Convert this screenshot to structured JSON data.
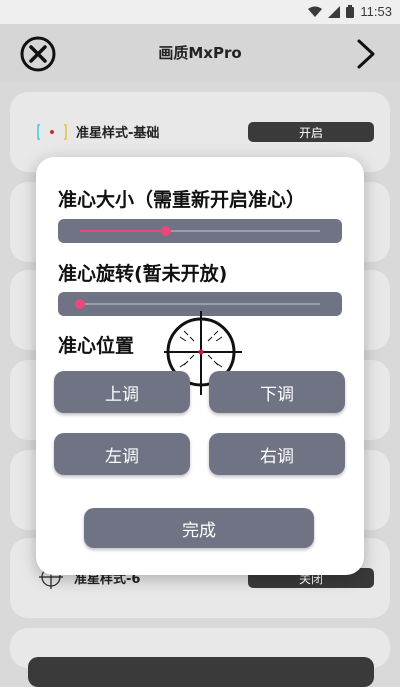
{
  "status_bar": {
    "time": "11:53"
  },
  "header": {
    "title": "画质MxPro"
  },
  "background": {
    "row_top": {
      "label": "准星样式-基础",
      "toggle": "开启"
    },
    "row_bottom": {
      "label": "准星样式-6",
      "toggle": "关闭"
    }
  },
  "dialog": {
    "size_label": "准心大小（需重新开启准心）",
    "size_value": 0.36,
    "rotation_label": "准心旋转(暂未开放)",
    "rotation_value": 0.0,
    "position_label": "准心位置",
    "up_button": "上调",
    "down_button": "下调",
    "left_button": "左调",
    "right_button": "右调",
    "done_button": "完成"
  },
  "colors": {
    "accent": "#e8487a",
    "button": "#6f7384",
    "dialog_bg": "#ffffff",
    "page_bg": "#d9d9d9"
  }
}
